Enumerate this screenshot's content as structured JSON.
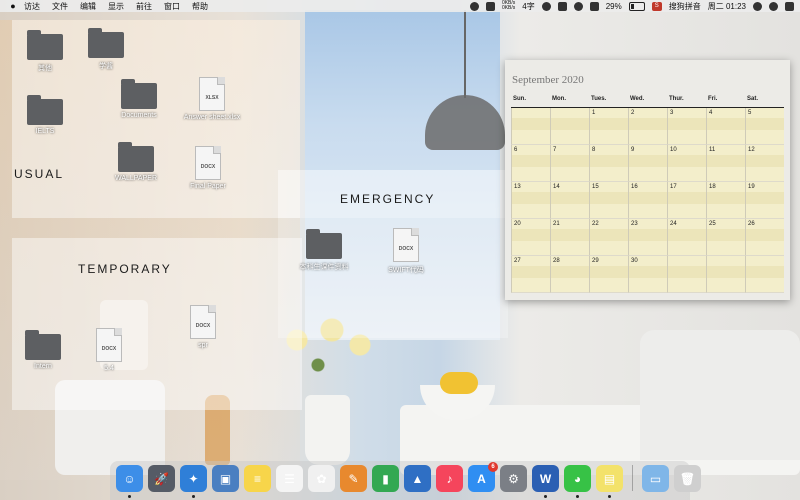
{
  "menubar": {
    "apple": "",
    "items": [
      "访达",
      "文件",
      "编辑",
      "显示",
      "前往",
      "窗口",
      "帮助"
    ],
    "net_up": "0KB/s",
    "net_down": "0KB/s",
    "ime_badge_label": "4字",
    "battery": "29%",
    "input_method": "搜狗拼音",
    "datetime": "周二 01:23"
  },
  "panels": {
    "usual": "USUAL",
    "temporary": "TEMPORARY",
    "emergency": "EMERGENCY"
  },
  "desktop_icons": [
    {
      "type": "folder",
      "label": "其他"
    },
    {
      "type": "folder",
      "label": "学酱"
    },
    {
      "type": "folder",
      "label": "IELTS"
    },
    {
      "type": "folder",
      "label": "Documents"
    },
    {
      "type": "doc",
      "ext": "XLSX",
      "label": "Answer sheet.xlsx"
    },
    {
      "type": "folder",
      "label": "WALLPAPER"
    },
    {
      "type": "doc",
      "ext": "DOCX",
      "label": "Final Paper"
    },
    {
      "type": "folder",
      "label": "本科生课件资料"
    },
    {
      "type": "doc",
      "ext": "DOCX",
      "label": "SWIFT代码"
    },
    {
      "type": "folder",
      "label": "Intern"
    },
    {
      "type": "doc",
      "ext": "DOCX",
      "label": "5.4"
    },
    {
      "type": "doc",
      "ext": "DOCX",
      "label": "spr"
    }
  ],
  "calendar": {
    "title": "September 2020",
    "days": [
      "Sun.",
      "Mon.",
      "Tues.",
      "Wed.",
      "Thur.",
      "Fri.",
      "Sat."
    ],
    "weeks": [
      [
        "",
        "",
        "1",
        "2",
        "3",
        "4",
        "5"
      ],
      [
        "6",
        "7",
        "8",
        "9",
        "10",
        "11",
        "12"
      ],
      [
        "13",
        "14",
        "15",
        "16",
        "17",
        "18",
        "19"
      ],
      [
        "20",
        "21",
        "22",
        "23",
        "24",
        "25",
        "26"
      ],
      [
        "27",
        "28",
        "29",
        "30",
        "",
        "",
        ""
      ]
    ]
  },
  "dock": {
    "items": [
      {
        "name": "finder-icon",
        "color": "#3d8ee8",
        "glyph": "☺",
        "running": true
      },
      {
        "name": "launchpad-icon",
        "color": "#555b66",
        "glyph": "🚀",
        "running": false
      },
      {
        "name": "safari-icon",
        "color": "#2f7fd8",
        "glyph": "✦",
        "running": true
      },
      {
        "name": "preview-icon",
        "color": "#4a7fc1",
        "glyph": "▣",
        "running": false
      },
      {
        "name": "notes-icon",
        "color": "#f7d54a",
        "glyph": "≡",
        "running": false
      },
      {
        "name": "reminders-icon",
        "color": "#f4f4f4",
        "glyph": "☰",
        "running": false
      },
      {
        "name": "photos-icon",
        "color": "#f0f0f0",
        "glyph": "✿",
        "running": false
      },
      {
        "name": "pages-icon",
        "color": "#e8892e",
        "glyph": "✎",
        "running": false
      },
      {
        "name": "numbers-icon",
        "color": "#33a852",
        "glyph": "▮",
        "running": false
      },
      {
        "name": "keynote-icon",
        "color": "#2f6fc4",
        "glyph": "▲",
        "running": false
      },
      {
        "name": "music-icon",
        "color": "#f5455c",
        "glyph": "♪",
        "running": false
      },
      {
        "name": "app-store-icon",
        "color": "#2f8ef2",
        "glyph": "A",
        "running": false,
        "badge": "6"
      },
      {
        "name": "system-preferences-icon",
        "color": "#7b7f86",
        "glyph": "⚙",
        "running": false
      },
      {
        "name": "word-icon",
        "color": "#2b5fb3",
        "glyph": "W",
        "running": true
      },
      {
        "name": "wechat-icon",
        "color": "#37c246",
        "glyph": "◕",
        "running": true
      },
      {
        "name": "stickies-icon",
        "color": "#f3e26a",
        "glyph": "▤",
        "running": true
      },
      {
        "name": "downloads-folder-icon",
        "color": "#7fb6e8",
        "glyph": "▭",
        "running": false
      },
      {
        "name": "trash-icon",
        "color": "#cfcfcf",
        "glyph": "🗑",
        "running": false
      }
    ]
  }
}
